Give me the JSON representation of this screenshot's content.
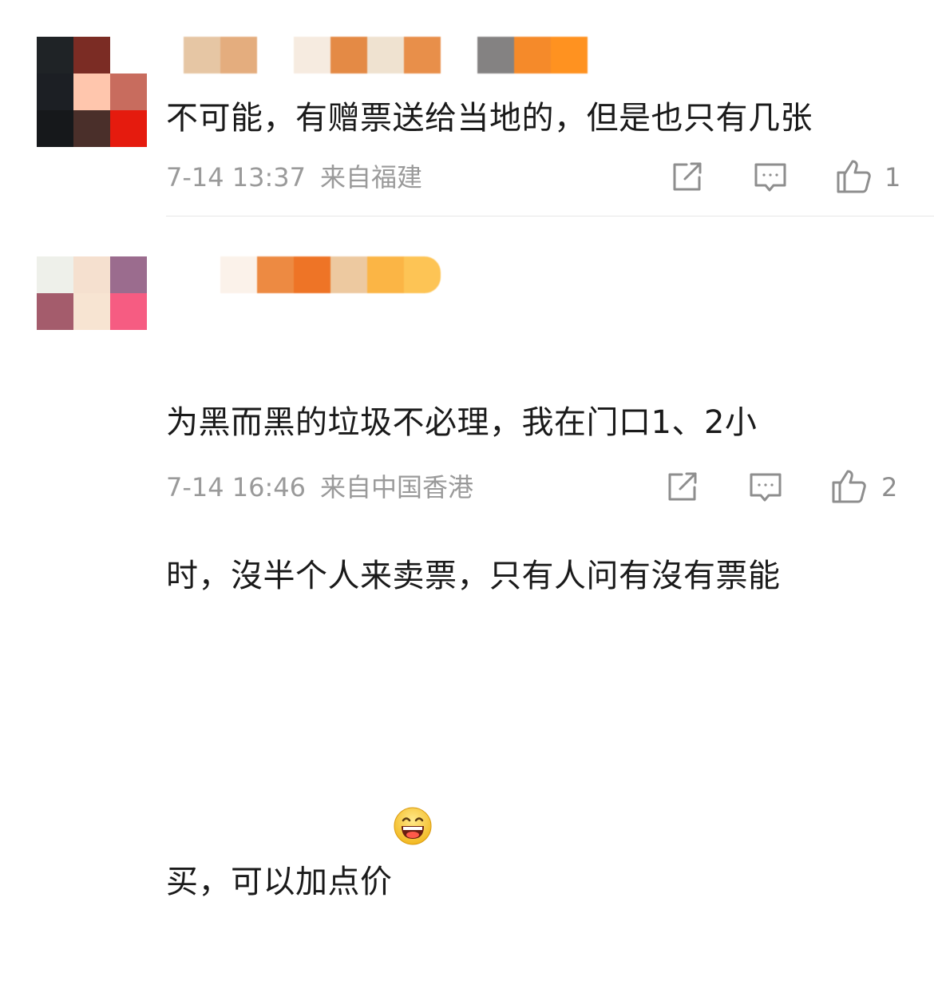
{
  "comments": [
    {
      "text": "不可能，有赠票送给当地的，但是也只有几张",
      "time": "7-14 13:37",
      "location": "来自福建",
      "likes": "1"
    },
    {
      "text_line1": "为黑而黑的垃圾不必理，我在门口1、2小",
      "text_line2": "时，沒半个人来卖票，只有人问有沒有票能",
      "text_line3": "买，可以加点价",
      "time": "7-14 16:46",
      "location": "来自中国香港",
      "likes": "2",
      "emoji": "laughing-face-icon"
    }
  ],
  "colors": {
    "text": "#1a1a1a",
    "meta": "#9a9a9a",
    "icon": "#8e8e8e",
    "divider": "#e6e6e6"
  }
}
